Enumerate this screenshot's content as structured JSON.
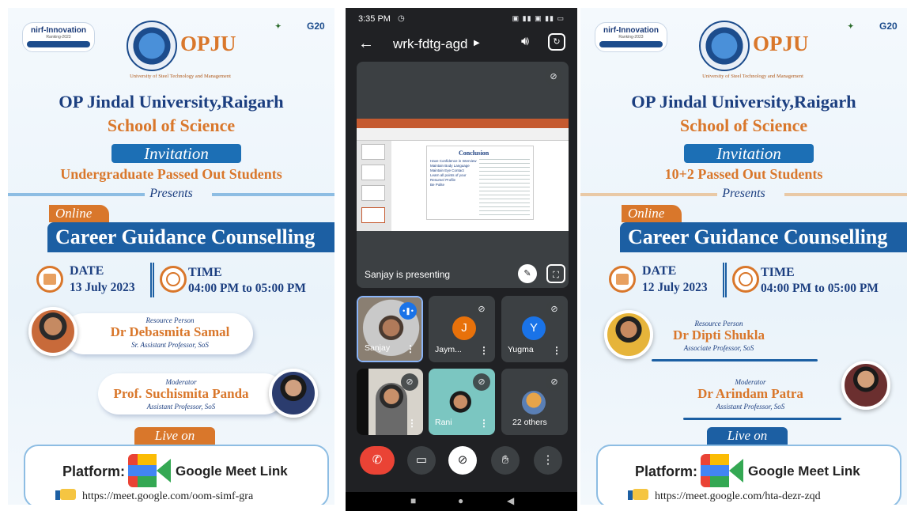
{
  "left_poster": {
    "nirf_title": "nirf-Innovation",
    "nirf_sub": "Ranking-2023",
    "logo_text": "OPJU",
    "logo_sub": "University of Steel Technology and Management",
    "g20_label": "G20",
    "university": "OP Jindal University,Raigarh",
    "school": "School of Science",
    "invitation": "Invitation",
    "audience": "Undergraduate Passed Out Students",
    "presents": "Presents",
    "online": "Online",
    "event": "Career Guidance Counselling",
    "date_label": "DATE",
    "date_value": "13 July 2023",
    "time_label": "TIME",
    "time_value": "04:00 PM to 05:00 PM",
    "resource_role": "Resource Person",
    "resource_name": "Dr Debasmita Samal",
    "resource_desig": "Sr. Assistant Professor, SoS",
    "moderator_role": "Moderator",
    "moderator_name": "Prof. Suchismita Panda",
    "moderator_desig": "Assistant Professor, SoS",
    "live_on": "Live on",
    "platform_label": "Platform:",
    "meet_label": "Google Meet Link",
    "url": "https://meet.google.com/oom-simf-gra"
  },
  "right_poster": {
    "nirf_title": "nirf-Innovation",
    "nirf_sub": "Ranking-2023",
    "logo_text": "OPJU",
    "logo_sub": "University of Steel Technology and Management",
    "g20_label": "G20",
    "university": "OP Jindal University,Raigarh",
    "school": "School of Science",
    "invitation": "Invitation",
    "audience": "10+2 Passed Out Students",
    "presents": "Presents",
    "online": "Online",
    "event": "Career Guidance Counselling",
    "date_label": "DATE",
    "date_value": "12 July 2023",
    "time_label": "TIME",
    "time_value": "04:00 PM to 05:00 PM",
    "resource_role": "Resource Person",
    "resource_name": "Dr Dipti Shukla",
    "resource_desig": "Associate Professor, SoS",
    "moderator_role": "Moderator",
    "moderator_name": "Dr Arindam Patra",
    "moderator_desig": "Assistant Professor, SoS",
    "live_on": "Live on",
    "platform_label": "Platform:",
    "meet_label": "Google Meet Link",
    "url": "https://meet.google.com/hta-dezr-zqd"
  },
  "phone": {
    "status_time": "3:35 PM",
    "meeting_code": "wrk-fdtg-agd",
    "presenting_text": "Sanjay is presenting",
    "slide": {
      "title": "Conclusion",
      "bullets": [
        "Have Confidence in Interview",
        "Maintain Body Language",
        "Maintain Eye Contact",
        "Learn all points of your Resume/ Profile",
        "Be Polite"
      ]
    },
    "participants": [
      {
        "name": "Sanjay",
        "initial": ""
      },
      {
        "name": "Jaym...",
        "initial": "J"
      },
      {
        "name": "Yugma",
        "initial": "Y"
      },
      {
        "name": "",
        "initial": ""
      },
      {
        "name": "Rani",
        "initial": ""
      },
      {
        "name": "22 others",
        "initial": ""
      }
    ],
    "colors": {
      "end_call": "#ea4335",
      "accent": "#8ab4f8",
      "avatar_j": "#e8710a",
      "avatar_y": "#1a73e8"
    }
  }
}
